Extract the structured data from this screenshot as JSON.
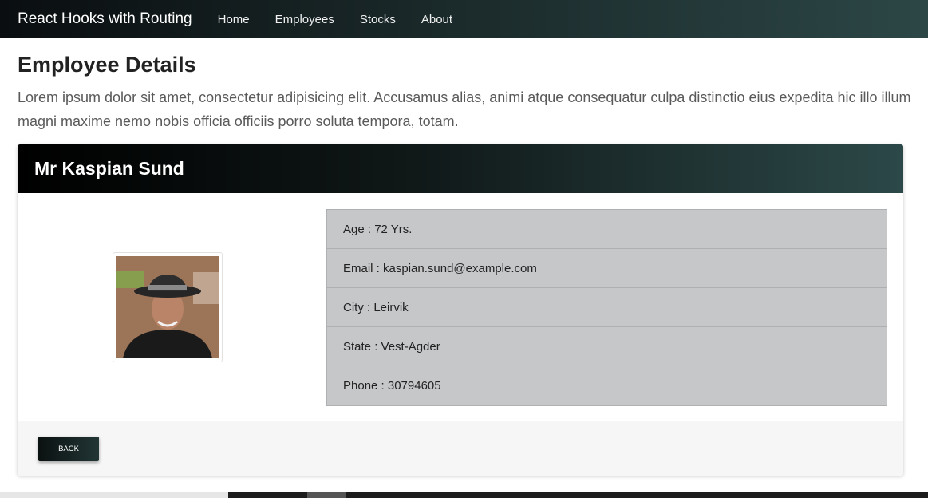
{
  "navbar": {
    "brand": "React Hooks with Routing",
    "links": [
      "Home",
      "Employees",
      "Stocks",
      "About"
    ]
  },
  "page": {
    "title": "Employee Details",
    "intro": "Lorem ipsum dolor sit amet, consectetur adipisicing elit. Accusamus alias, animi atque consequatur culpa distinctio eius expedita hic illo illum magni maxime nemo nobis officia officiis porro soluta tempora, totam."
  },
  "employee": {
    "name": "Mr Kaspian Sund",
    "details": [
      "Age : 72 Yrs.",
      "Email : kaspian.sund@example.com",
      "City : Leirvik",
      "State : Vest-Agder",
      "Phone : 30794605"
    ]
  },
  "footer": {
    "back_label": "BACK"
  },
  "colors": {
    "accent_dark": "#0a0e10",
    "accent_teal": "#2c4646",
    "detail_bg": "#c6c7c9"
  }
}
